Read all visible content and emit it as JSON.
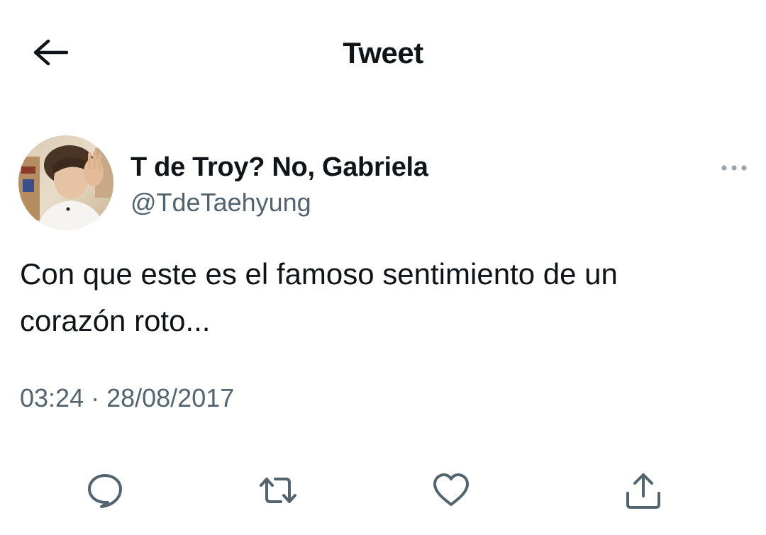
{
  "header": {
    "title": "Tweet",
    "back_icon": "arrow-left-icon"
  },
  "tweet": {
    "author": {
      "display_name": "T de Troy? No, Gabriela",
      "handle": "@TdeTaehyung",
      "avatar_icon": "profile-photo"
    },
    "more_icon": "more-horizontal-icon",
    "text_line_1": "Con que este es el famoso sentimiento de un",
    "text_line_2": "corazón roto...",
    "timestamp": "03:24 · 28/08/2017"
  },
  "actions": [
    {
      "name": "reply",
      "icon": "reply-icon"
    },
    {
      "name": "retweet",
      "icon": "retweet-icon"
    },
    {
      "name": "like",
      "icon": "heart-icon"
    },
    {
      "name": "share",
      "icon": "share-icon"
    }
  ],
  "colors": {
    "text_primary": "#0f1419",
    "text_secondary": "#536471",
    "background": "#ffffff"
  }
}
